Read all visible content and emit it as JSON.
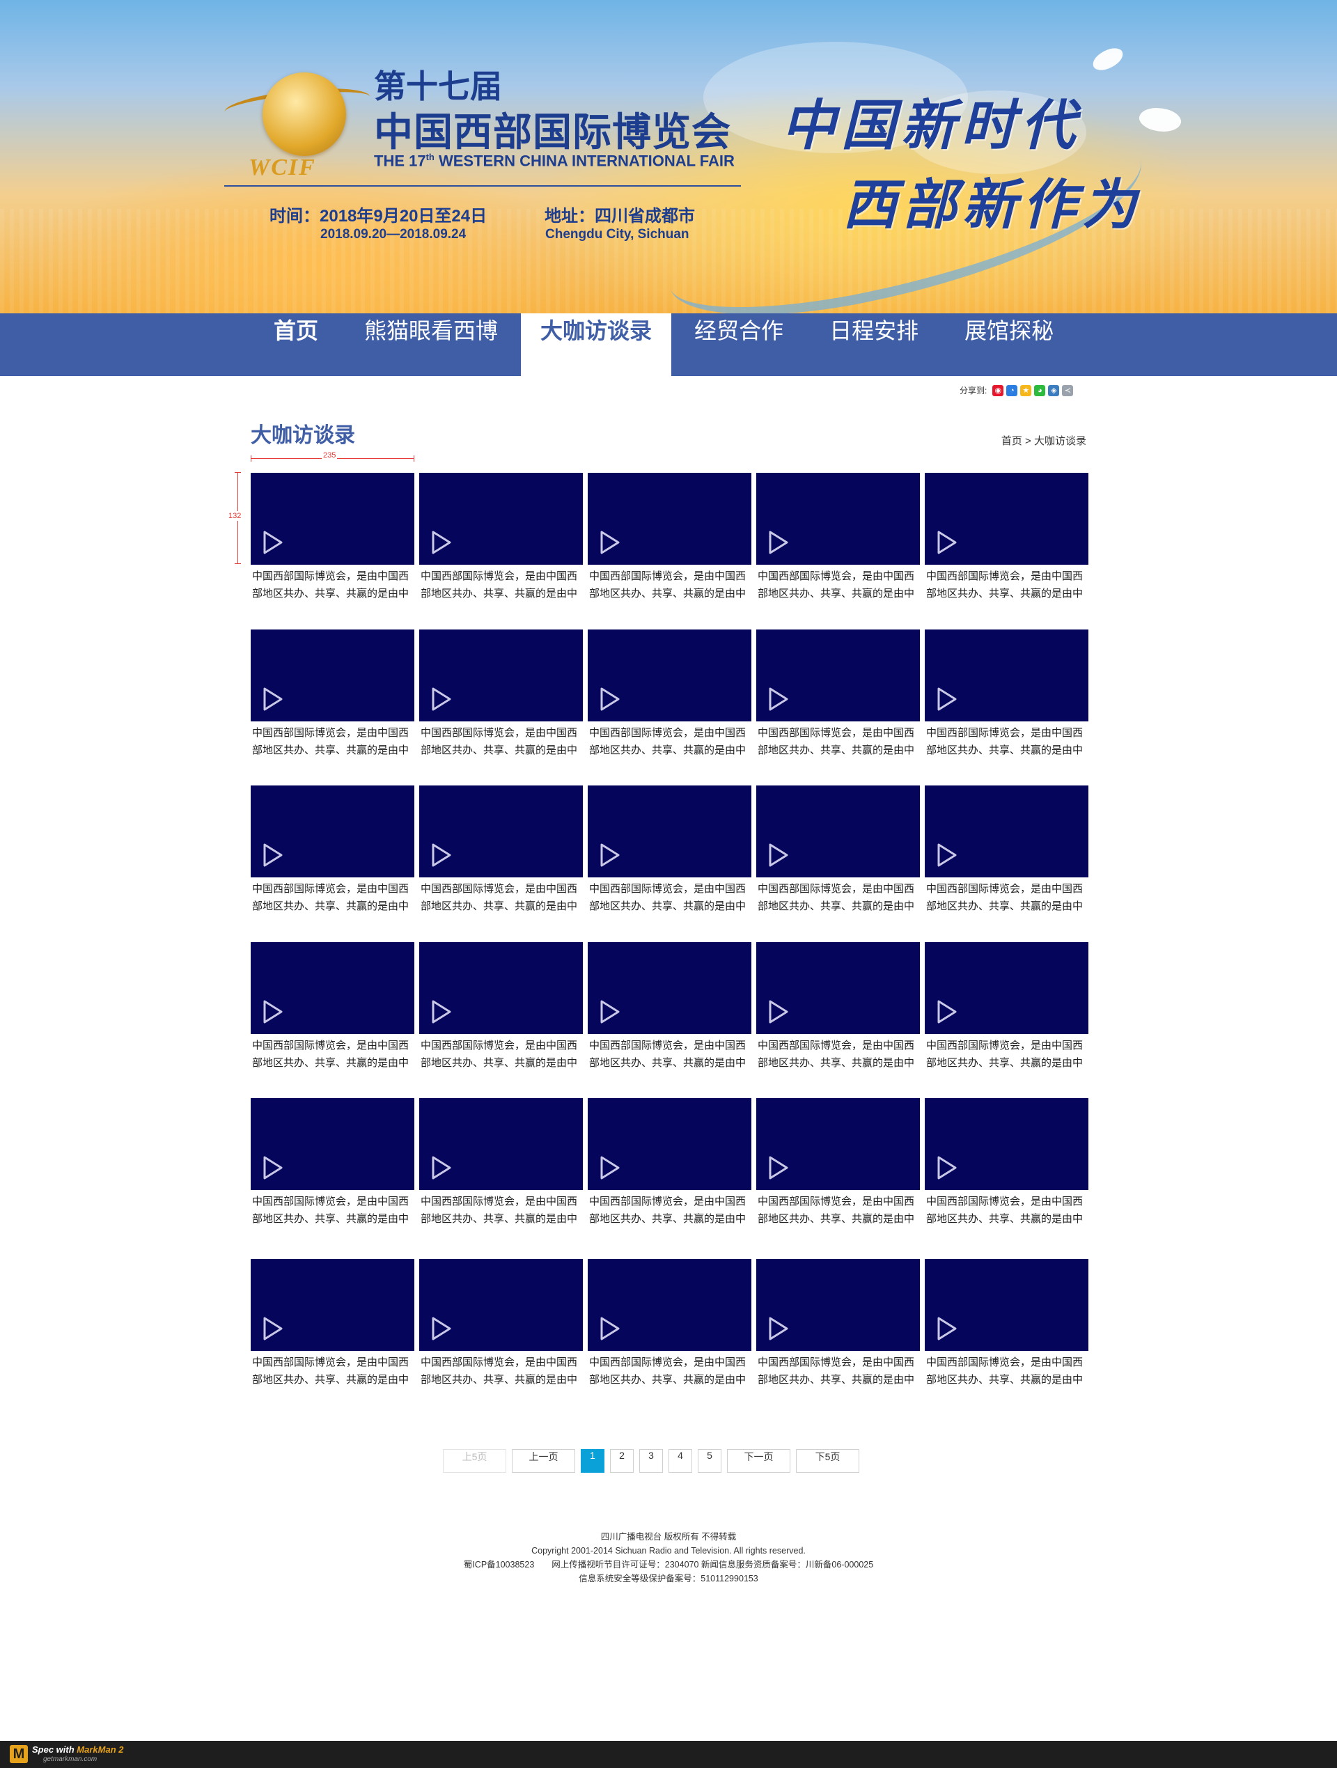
{
  "banner": {
    "logo_text": "WCIF",
    "edition": "第十七届",
    "name_cn": "中国西部国际博览会",
    "name_en_prefix": "THE 17",
    "name_en_sup": "th",
    "name_en_suffix": " WESTERN CHINA INTERNATIONAL FAIR",
    "time_label": "时间：2018年9月20日至24日",
    "time_sub": "2018.09.20—2018.09.24",
    "address_label": "地址：四川省成都市",
    "address_sub": "Chengdu City, Sichuan",
    "slogan_line1": "中国新时代",
    "slogan_line2": "西部新作为"
  },
  "nav": {
    "items": [
      {
        "label": "首页"
      },
      {
        "label": "熊猫眼看西博"
      },
      {
        "label": "大咖访谈录"
      },
      {
        "label": "经贸合作"
      },
      {
        "label": "日程安排"
      },
      {
        "label": "展馆探秘"
      }
    ],
    "active_index": 2
  },
  "share": {
    "label": "分享到:",
    "icons": [
      "weibo-icon",
      "qq-icon",
      "qzone-icon",
      "wechat-icon",
      "renren-icon",
      "more-share-icon"
    ]
  },
  "page": {
    "title": "大咖访谈录",
    "breadcrumb": "首页 > 大咖访谈录"
  },
  "spec": {
    "width_label": "235",
    "height_label": "132"
  },
  "videos": {
    "caption_line1": "中国西部国际博览会，是由中国西",
    "caption_line2": "部地区共办、共享、共赢的是由中",
    "rows": 6,
    "cols": 5
  },
  "pagination": {
    "first_label": "上5页",
    "prev_label": "上一页",
    "pages": [
      "1",
      "2",
      "3",
      "4",
      "5"
    ],
    "current": "1",
    "next_label": "下一页",
    "last_label": "下5页"
  },
  "footer": {
    "line1": "四川广播电视台 版权所有 不得转载",
    "line2": "Copyright 2001-2014 Sichuan Radio and Television. All rights reserved.",
    "line3": "蜀ICP备10038523　　网上传播视听节目许可证号：2304070 新闻信息服务资质备案号：川新备06-000025",
    "line4": "信息系统安全等级保护备案号：510112990153"
  },
  "markman": {
    "spec_with": "Spec with ",
    "brand": "MarkMan 2",
    "url": "getmarkman.com"
  },
  "colors": {
    "nav_bg": "#3f5ea6",
    "thumb_bg": "#06055c",
    "pager_active": "#0aa0d8",
    "title_blue": "#3f5ea6"
  }
}
